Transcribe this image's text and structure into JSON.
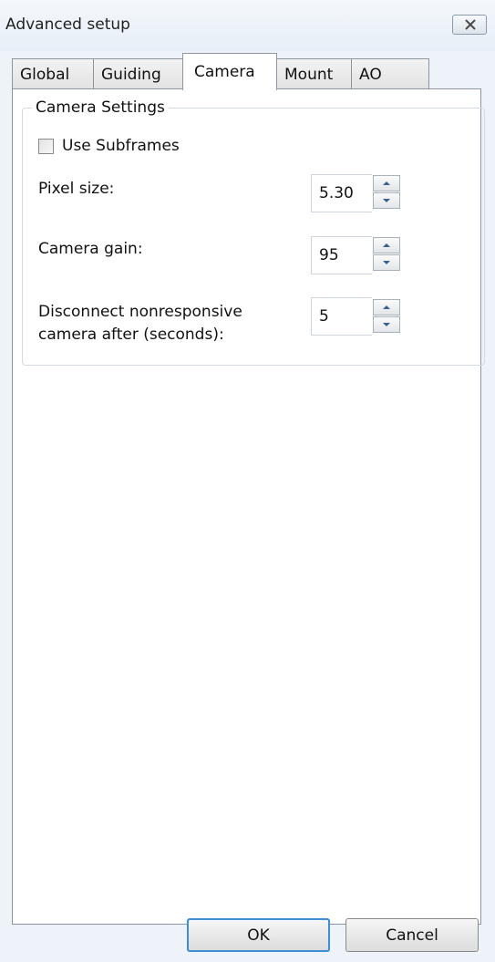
{
  "window": {
    "title": "Advanced setup",
    "close_icon": "close-icon"
  },
  "tabs": [
    {
      "label": "Global",
      "active": false
    },
    {
      "label": "Guiding",
      "active": false
    },
    {
      "label": "Camera",
      "active": true
    },
    {
      "label": "Mount",
      "active": false
    },
    {
      "label": "AO",
      "active": false
    }
  ],
  "camera_settings": {
    "group_title": "Camera Settings",
    "use_subframes": {
      "label": "Use Subframes",
      "checked": false
    },
    "pixel_size": {
      "label": "Pixel size:",
      "value": "5.30"
    },
    "camera_gain": {
      "label": "Camera gain:",
      "value": "95"
    },
    "disconnect": {
      "label_line1": "Disconnect nonresponsive",
      "label_line2": "camera after (seconds):",
      "value": "5"
    }
  },
  "buttons": {
    "ok": "OK",
    "cancel": "Cancel"
  },
  "colors": {
    "accent": "#3c8fd6",
    "panel": "#ffffff",
    "window_bg": "#eef3f9"
  }
}
